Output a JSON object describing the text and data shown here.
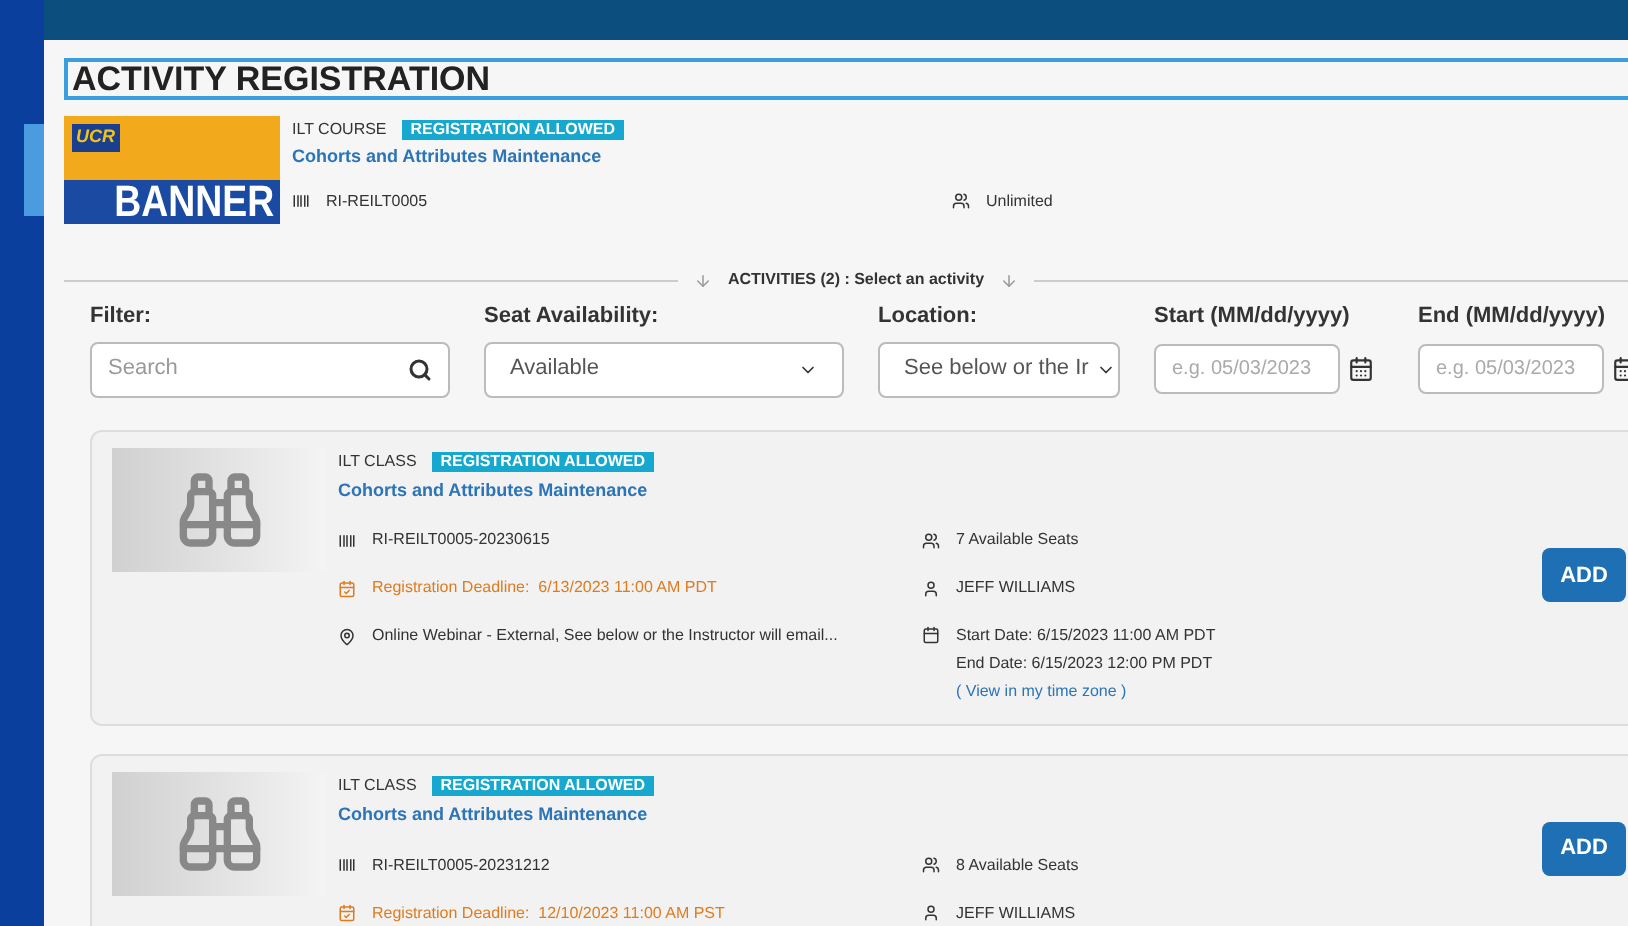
{
  "page_title": "ACTIVITY REGISTRATION",
  "logo": {
    "top": "UCR",
    "bottom": "BANNER"
  },
  "course": {
    "type": "ILT COURSE",
    "badge": "REGISTRATION ALLOWED",
    "title": "Cohorts and Attributes Maintenance",
    "code": "RI-REILT0005",
    "seats": "Unlimited"
  },
  "activities_header": "ACTIVITIES (2) : Select an activity",
  "filters": [
    {
      "kind": "search",
      "label": "Filter:",
      "placeholder": "Search"
    },
    {
      "kind": "select",
      "label": "Seat Availability:",
      "value": "Available"
    },
    {
      "kind": "select",
      "label": "Location:",
      "value": "See below or the Ir"
    },
    {
      "kind": "date",
      "label": "Start (MM/dd/yyyy)",
      "placeholder": "e.g. 05/03/2023"
    },
    {
      "kind": "date",
      "label": "End (MM/dd/yyyy)",
      "placeholder": "e.g. 05/03/2023"
    }
  ],
  "activities": [
    {
      "type": "ILT CLASS",
      "badge": "REGISTRATION ALLOWED",
      "title": "Cohorts and Attributes Maintenance",
      "code": "RI-REILT0005-20230615",
      "seats": "7 Available Seats",
      "deadline": "Registration Deadline:  6/13/2023 11:00 AM PDT",
      "instructor": "JEFF WILLIAMS",
      "location": "Online Webinar - External, See below or the Instructor will email...",
      "start": "Start Date: 6/15/2023 11:00 AM PDT",
      "end": "End Date: 6/15/2023 12:00 PM PDT",
      "timezone_link": "( View in my time zone )",
      "button": "ADD"
    },
    {
      "type": "ILT CLASS",
      "badge": "REGISTRATION ALLOWED",
      "title": "Cohorts and Attributes Maintenance",
      "code": "RI-REILT0005-20231212",
      "seats": "8 Available Seats",
      "deadline": "Registration Deadline:  12/10/2023 11:00 AM PST",
      "instructor": "JEFF WILLIAMS",
      "button": "ADD"
    }
  ]
}
